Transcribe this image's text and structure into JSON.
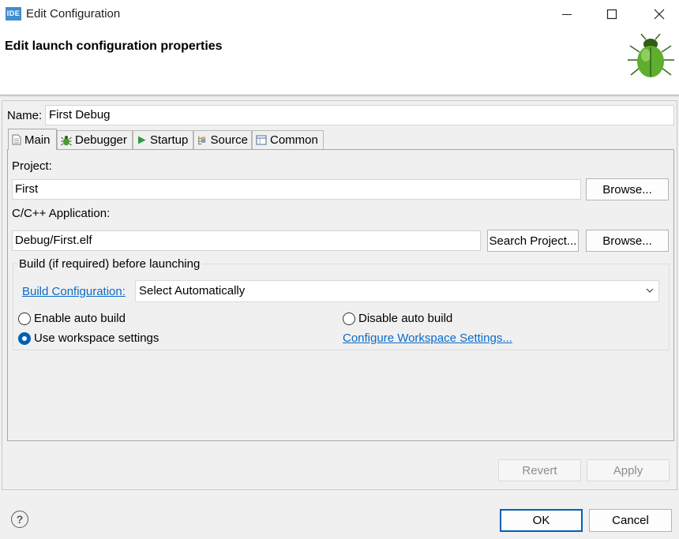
{
  "window": {
    "app_icon_text": "IDE",
    "title": "Edit Configuration"
  },
  "header": {
    "title": "Edit launch configuration properties"
  },
  "name_field": {
    "label": "Name:",
    "value": "First Debug"
  },
  "tabs": [
    {
      "label": "Main",
      "icon": "document-icon",
      "active": true
    },
    {
      "label": "Debugger",
      "icon": "bug-icon",
      "active": false
    },
    {
      "label": "Startup",
      "icon": "play-icon",
      "active": false
    },
    {
      "label": "Source",
      "icon": "source-icon",
      "active": false
    },
    {
      "label": "Common",
      "icon": "table-icon",
      "active": false
    }
  ],
  "main": {
    "project_label": "Project:",
    "project_value": "First",
    "project_browse": "Browse...",
    "application_label": "C/C++ Application:",
    "application_value": "Debug/First.elf",
    "search_project": "Search Project...",
    "application_browse": "Browse...",
    "build": {
      "group_title": "Build (if required) before launching",
      "config_link": "Build Configuration:",
      "config_value": "Select Automatically",
      "enable_auto_build": "Enable auto build",
      "disable_auto_build": "Disable auto build",
      "use_workspace_settings": "Use workspace settings",
      "configure_link": "Configure Workspace Settings...",
      "selected": "use_workspace_settings"
    }
  },
  "footer": {
    "revert": "Revert",
    "apply": "Apply",
    "ok": "OK",
    "cancel": "Cancel",
    "help_symbol": "?"
  },
  "colors": {
    "accent": "#005fb8",
    "link": "#0b6ac7",
    "app_icon": "#3f8fd1"
  }
}
